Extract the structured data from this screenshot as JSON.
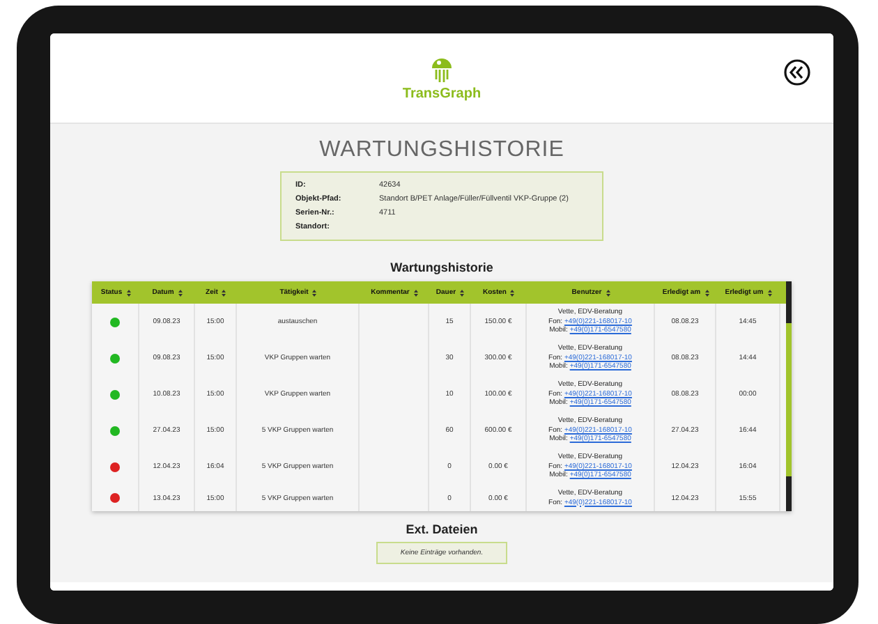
{
  "header": {
    "logo_text": "TransGraph"
  },
  "title": "WARTUNGSHISTORIE",
  "info": [
    {
      "label": "ID:",
      "value": "42634"
    },
    {
      "label": "Objekt-Pfad:",
      "value": "Standort B/PET Anlage/Füller/Füllventil VKP-Gruppe (2)"
    },
    {
      "label": "Serien-Nr.:",
      "value": "4711"
    },
    {
      "label": "Standort:"
    }
  ],
  "history": {
    "heading": "Wartungshistorie",
    "columns": [
      "Status",
      "Datum",
      "Zeit",
      "Tätigkeit",
      "Kommentar",
      "Dauer",
      "Kosten",
      "Benutzer",
      "Erledigt am",
      "Erledigt um"
    ],
    "rows": [
      {
        "color": "#22b822",
        "datum": "09.08.23",
        "zeit": "15:00",
        "taetigkeit": "austauschen",
        "dauer": "15",
        "kosten": "150.00 €",
        "user": "Vette, EDV-Beratung",
        "fon_label": "Fon:",
        "fon": "+49(0)221-168017-10",
        "mobil_label": "Mobil:",
        "mobil": "+49(0)171-6547580",
        "erledigt_am": "08.08.23",
        "erledigt_um": "14:45"
      },
      {
        "color": "#22b822",
        "datum": "09.08.23",
        "zeit": "15:00",
        "taetigkeit": "VKP Gruppen warten",
        "dauer": "30",
        "kosten": "300.00 €",
        "user": "Vette, EDV-Beratung",
        "fon_label": "Fon:",
        "fon": "+49(0)221-168017-10",
        "mobil_label": "Mobil:",
        "mobil": "+49(0)171-6547580",
        "erledigt_am": "08.08.23",
        "erledigt_um": "14:44"
      },
      {
        "color": "#22b822",
        "datum": "10.08.23",
        "zeit": "15:00",
        "taetigkeit": "VKP Gruppen warten",
        "dauer": "10",
        "kosten": "100.00 €",
        "user": "Vette, EDV-Beratung",
        "fon_label": "Fon:",
        "fon": "+49(0)221-168017-10",
        "mobil_label": "Mobil:",
        "mobil": "+49(0)171-6547580",
        "erledigt_am": "08.08.23",
        "erledigt_um": "00:00"
      },
      {
        "color": "#22b822",
        "datum": "27.04.23",
        "zeit": "15:00",
        "taetigkeit": "5 VKP Gruppen warten",
        "dauer": "60",
        "kosten": "600.00 €",
        "user": "Vette, EDV-Beratung",
        "fon_label": "Fon:",
        "fon": "+49(0)221-168017-10",
        "mobil_label": "Mobil:",
        "mobil": "+49(0)171-6547580",
        "erledigt_am": "27.04.23",
        "erledigt_um": "16:44"
      },
      {
        "color": "#dd2222",
        "datum": "12.04.23",
        "zeit": "16:04",
        "taetigkeit": "5 VKP Gruppen warten",
        "dauer": "0",
        "kosten": "0.00 €",
        "user": "Vette, EDV-Beratung",
        "fon_label": "Fon:",
        "fon": "+49(0)221-168017-10",
        "mobil_label": "Mobil:",
        "mobil": "+49(0)171-6547580",
        "erledigt_am": "12.04.23",
        "erledigt_um": "16:04"
      },
      {
        "color": "#dd2222",
        "datum": "13.04.23",
        "zeit": "15:00",
        "taetigkeit": "5 VKP Gruppen warten",
        "dauer": "0",
        "kosten": "0.00 €",
        "user": "Vette, EDV-Beratung",
        "fon_label": "Fon:",
        "fon": "+49(0)221-168017-10",
        "erledigt_am": "12.04.23",
        "erledigt_um": "15:55"
      }
    ]
  },
  "files": {
    "heading": "Ext. Dateien",
    "empty": "Keine Einträge vorhanden."
  }
}
